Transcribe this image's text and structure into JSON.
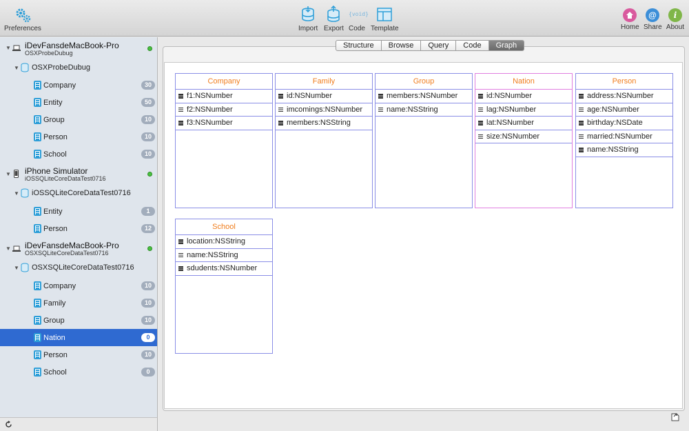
{
  "toolbar": {
    "preferences": "Preferences",
    "import": "Import",
    "export": "Export",
    "code": "Code",
    "code_glyph": "{void}",
    "template": "Template",
    "home": "Home",
    "share": "Share",
    "about": "About",
    "share_glyph": "@",
    "about_glyph": "i",
    "colors": {
      "home": "#d95a9e",
      "share": "#3b8ed8",
      "about": "#7fb648",
      "accent": "#2d9ed8"
    }
  },
  "sidebar": {
    "devices": [
      {
        "name": "iDevFansdeMacBook-Pro",
        "sub": "OSXProbeDubug",
        "icon": "laptop-icon",
        "database": "OSXProbeDubug",
        "entities": [
          {
            "label": "Company",
            "count": "30"
          },
          {
            "label": "Entity",
            "count": "50"
          },
          {
            "label": "Group",
            "count": "10"
          },
          {
            "label": "Person",
            "count": "10"
          },
          {
            "label": "School",
            "count": "10"
          }
        ]
      },
      {
        "name": "iPhone Simulator",
        "sub": "iOSSQLiteCoreDataTest0716",
        "icon": "phone-icon",
        "database": "iOSSQLiteCoreDataTest0716",
        "entities": [
          {
            "label": "Entity",
            "count": "1"
          },
          {
            "label": "Person",
            "count": "12"
          }
        ]
      },
      {
        "name": "iDevFansdeMacBook-Pro",
        "sub": "OSXSQLiteCoreDataTest0716",
        "icon": "laptop-icon",
        "database": "OSXSQLiteCoreDataTest0716",
        "entities": [
          {
            "label": "Company",
            "count": "10"
          },
          {
            "label": "Family",
            "count": "10"
          },
          {
            "label": "Group",
            "count": "10"
          },
          {
            "label": "Nation",
            "count": "0",
            "selected": true
          },
          {
            "label": "Person",
            "count": "10"
          },
          {
            "label": "School",
            "count": "0"
          }
        ]
      }
    ]
  },
  "tabs": [
    "Structure",
    "Browse",
    "Query",
    "Code",
    "Graph"
  ],
  "active_tab": "Graph",
  "graph": {
    "entities": [
      {
        "name": "Company",
        "attributes": [
          "f1:NSNumber",
          "f2:NSNumber",
          "f3:NSNumber"
        ]
      },
      {
        "name": "Family",
        "attributes": [
          "id:NSNumber",
          "imcomings:NSNumber",
          "members:NSString"
        ]
      },
      {
        "name": "Group",
        "attributes": [
          "members:NSNumber",
          "name:NSString"
        ]
      },
      {
        "name": "Nation",
        "attributes": [
          "id:NSNumber",
          "lag:NSNumber",
          "lat:NSNumber",
          "size:NSNumber"
        ],
        "highlighted": true
      },
      {
        "name": "Person",
        "attributes": [
          "address:NSNumber",
          "age:NSNumber",
          "birthday:NSDate",
          "married:NSNumber",
          "name:NSString"
        ]
      },
      {
        "name": "School",
        "attributes": [
          "location:NSString",
          "name:NSString",
          "sdudents:NSNumber"
        ]
      }
    ]
  }
}
